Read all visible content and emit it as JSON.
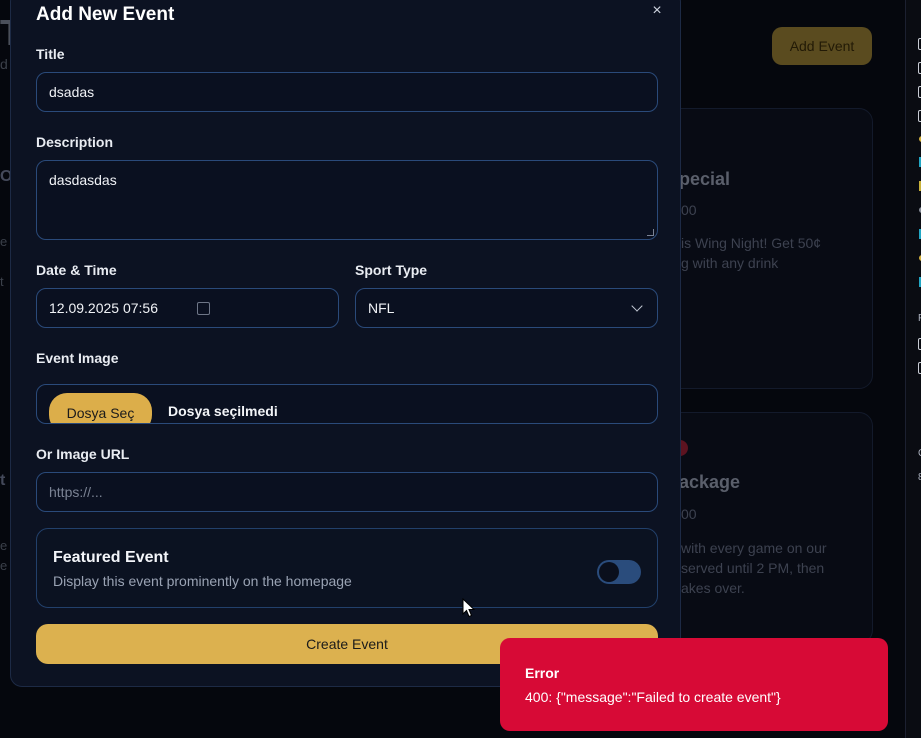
{
  "background": {
    "add_event_label": "Add Event",
    "header_letter": "T",
    "header_sub": "d",
    "cards": [
      {
        "title_fragment": "pecial",
        "price_fragment": "00",
        "desc_line1": "is Wing Night! Get 50¢",
        "desc_line2": "g with any drink"
      },
      {
        "title_fragment": "ackage",
        "price_fragment": "00",
        "desc_line1": "with every game on our",
        "desc_line2": "served until 2 PM, then",
        "desc_line3": "akes over."
      }
    ],
    "left_fragments": [
      "Or",
      "e",
      "t",
      "t",
      "e",
      "e"
    ],
    "strip_labels": [
      "P",
      "C",
      "8"
    ]
  },
  "modal": {
    "title": "Add New Event",
    "close_glyph": "×",
    "fields": {
      "title_label": "Title",
      "title_value": "dsadas",
      "description_label": "Description",
      "description_value": "dasdasdas",
      "datetime_label": "Date & Time",
      "datetime_value": "12.09.2025 07:56",
      "sport_label": "Sport Type",
      "sport_value": "NFL",
      "image_label": "Event Image",
      "file_button": "Dosya Seç",
      "file_status": "Dosya seçilmedi",
      "image_url_label": "Or Image URL",
      "image_url_placeholder": "https://..."
    },
    "featured": {
      "title": "Featured Event",
      "description": "Display this event prominently on the homepage",
      "enabled": false
    },
    "submit_label": "Create Event"
  },
  "toast": {
    "title": "Error",
    "message": "400: {\"message\":\"Failed to create event\"}"
  },
  "colors": {
    "accent": "#dcb14f",
    "error": "#d70a36",
    "modal_bg": "#0c1222",
    "field_border": "#2a4a7a"
  }
}
